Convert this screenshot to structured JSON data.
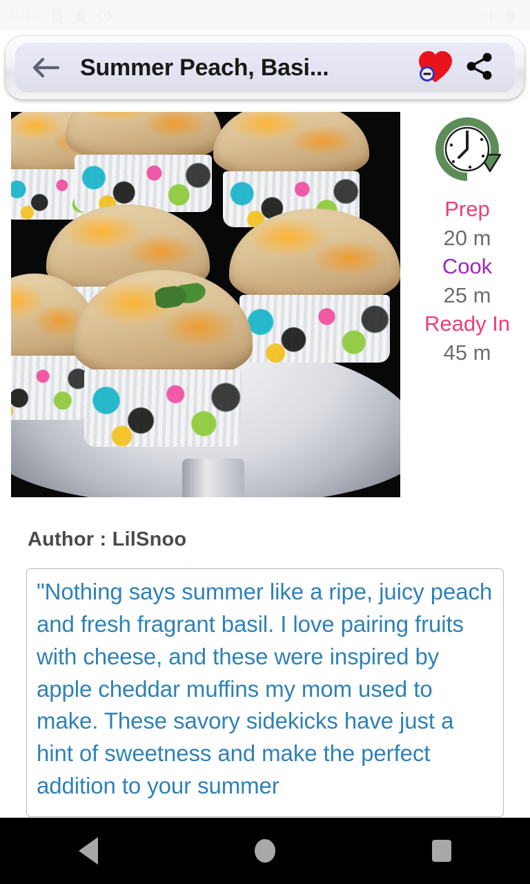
{
  "status_bar": {
    "time": "6:13",
    "left_icons": [
      "sim-card-icon",
      "battery-saver-icon",
      "alarm-icon"
    ],
    "right_icons": [
      "airplane-mode-icon",
      "battery-icon"
    ]
  },
  "toolbar": {
    "back_label": "back-arrow",
    "title": "Summer Peach, Basi...",
    "favorite_label": "heart-remove",
    "share_label": "share"
  },
  "recipe": {
    "photo_alt": "Cheddar muffins in colorful floral liners on a white cake stand",
    "times": [
      {
        "label": "Prep",
        "value": "20 m",
        "color": "#ee3d7b"
      },
      {
        "label": "Cook",
        "value": "25 m",
        "color": "#a224c4"
      },
      {
        "label": "Ready In",
        "value": "45 m",
        "color": "#ee3d7b"
      }
    ],
    "author": "Author : LilSnoo",
    "description": "\"Nothing says summer like a ripe, juicy peach and fresh fragrant basil. I love pairing fruits with cheese, and these were inspired by apple cheddar muffins my mom used to make. These savory sidekicks have just a hint of sweetness and make the perfect addition to your summer"
  },
  "nav_bar": {
    "back": "back",
    "home": "home",
    "recents": "recents"
  },
  "colors": {
    "accent_pink": "#ee3d7b",
    "accent_purple": "#a224c4",
    "description_text": "#2e81b8",
    "clock_green": "#5c8c58",
    "value_gray": "#6d6d6d"
  }
}
